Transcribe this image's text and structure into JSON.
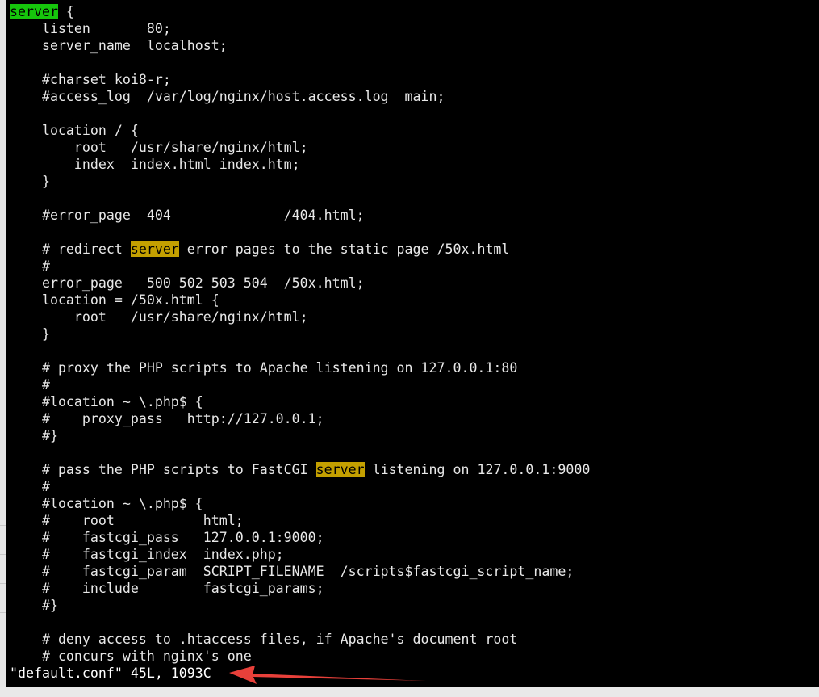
{
  "editor": {
    "lines": [
      {
        "segments": [
          {
            "text": "server",
            "hl": "cursor"
          },
          {
            "text": " {"
          }
        ]
      },
      {
        "segments": [
          {
            "text": "    listen       80;"
          }
        ]
      },
      {
        "segments": [
          {
            "text": "    server_name  localhost;"
          }
        ]
      },
      {
        "segments": [
          {
            "text": ""
          }
        ]
      },
      {
        "segments": [
          {
            "text": "    #charset koi8-r;"
          }
        ]
      },
      {
        "segments": [
          {
            "text": "    #access_log  /var/log/nginx/host.access.log  main;"
          }
        ]
      },
      {
        "segments": [
          {
            "text": ""
          }
        ]
      },
      {
        "segments": [
          {
            "text": "    location / {"
          }
        ]
      },
      {
        "segments": [
          {
            "text": "        root   /usr/share/nginx/html;"
          }
        ]
      },
      {
        "segments": [
          {
            "text": "        index  index.html index.htm;"
          }
        ]
      },
      {
        "segments": [
          {
            "text": "    }"
          }
        ]
      },
      {
        "segments": [
          {
            "text": ""
          }
        ]
      },
      {
        "segments": [
          {
            "text": "    #error_page  404              /404.html;"
          }
        ]
      },
      {
        "segments": [
          {
            "text": ""
          }
        ]
      },
      {
        "segments": [
          {
            "text": "    # redirect "
          },
          {
            "text": "server",
            "hl": "search"
          },
          {
            "text": " error pages to the static page /50x.html"
          }
        ]
      },
      {
        "segments": [
          {
            "text": "    #"
          }
        ]
      },
      {
        "segments": [
          {
            "text": "    error_page   500 502 503 504  /50x.html;"
          }
        ]
      },
      {
        "segments": [
          {
            "text": "    location = /50x.html {"
          }
        ]
      },
      {
        "segments": [
          {
            "text": "        root   /usr/share/nginx/html;"
          }
        ]
      },
      {
        "segments": [
          {
            "text": "    }"
          }
        ]
      },
      {
        "segments": [
          {
            "text": ""
          }
        ]
      },
      {
        "segments": [
          {
            "text": "    # proxy the PHP scripts to Apache listening on 127.0.0.1:80"
          }
        ]
      },
      {
        "segments": [
          {
            "text": "    #"
          }
        ]
      },
      {
        "segments": [
          {
            "text": "    #location ~ \\.php$ {"
          }
        ]
      },
      {
        "segments": [
          {
            "text": "    #    proxy_pass   http://127.0.0.1;"
          }
        ]
      },
      {
        "segments": [
          {
            "text": "    #}"
          }
        ]
      },
      {
        "segments": [
          {
            "text": ""
          }
        ]
      },
      {
        "segments": [
          {
            "text": "    # pass the PHP scripts to FastCGI "
          },
          {
            "text": "server",
            "hl": "search"
          },
          {
            "text": " listening on 127.0.0.1:9000"
          }
        ]
      },
      {
        "segments": [
          {
            "text": "    #"
          }
        ]
      },
      {
        "segments": [
          {
            "text": "    #location ~ \\.php$ {"
          }
        ]
      },
      {
        "segments": [
          {
            "text": "    #    root           html;"
          }
        ]
      },
      {
        "segments": [
          {
            "text": "    #    fastcgi_pass   127.0.0.1:9000;"
          }
        ]
      },
      {
        "segments": [
          {
            "text": "    #    fastcgi_index  index.php;"
          }
        ]
      },
      {
        "segments": [
          {
            "text": "    #    fastcgi_param  SCRIPT_FILENAME  /scripts$fastcgi_script_name;"
          }
        ]
      },
      {
        "segments": [
          {
            "text": "    #    include        fastcgi_params;"
          }
        ]
      },
      {
        "segments": [
          {
            "text": "    #}"
          }
        ]
      },
      {
        "segments": [
          {
            "text": ""
          }
        ]
      },
      {
        "segments": [
          {
            "text": "    # deny access to .htaccess files, if Apache's document root"
          }
        ]
      },
      {
        "segments": [
          {
            "text": "    # concurs with nginx's one"
          }
        ]
      }
    ],
    "status_line": "\"default.conf\" 45L, 1093C"
  },
  "colors": {
    "background": "#000000",
    "text": "#e8e8e8",
    "cursor_highlight": "#16c60c",
    "search_highlight": "#c4a000",
    "annotation_arrow": "#e8403a"
  },
  "annotation": {
    "icon": "red-arrow-icon"
  }
}
